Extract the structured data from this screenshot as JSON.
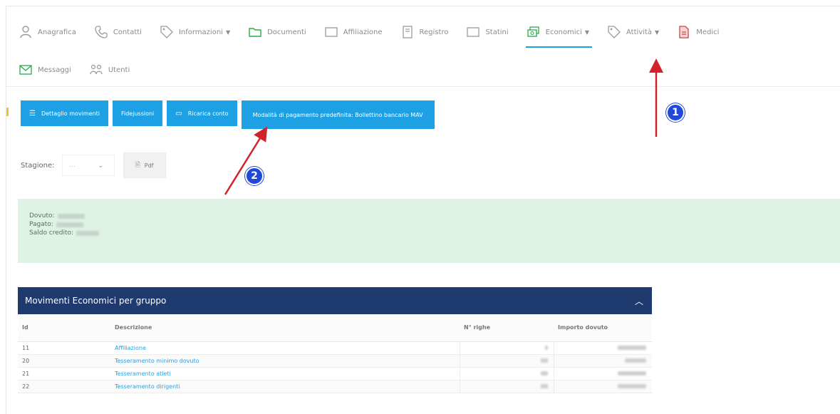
{
  "nav": {
    "row1": [
      {
        "label": "Anagrafica",
        "icon": "person-icon",
        "caret": false
      },
      {
        "label": "Contatti",
        "icon": "phone-icon",
        "caret": false
      },
      {
        "label": "Informazioni",
        "icon": "tag-icon",
        "caret": true
      },
      {
        "label": "Documenti",
        "icon": "folder-icon",
        "caret": false
      },
      {
        "label": "Affiliazione",
        "icon": "frame-icon",
        "caret": false
      },
      {
        "label": "Registro",
        "icon": "book-icon",
        "caret": false
      },
      {
        "label": "Statini",
        "icon": "frame-icon",
        "caret": false
      },
      {
        "label": "Economici",
        "icon": "money-icon",
        "caret": true,
        "active": true
      },
      {
        "label": "Attività",
        "icon": "tag-icon",
        "caret": true
      },
      {
        "label": "Medici",
        "icon": "file-icon",
        "caret": false
      }
    ],
    "row2": [
      {
        "label": "Messaggi",
        "icon": "envelope-icon"
      },
      {
        "label": "Utenti",
        "icon": "users-icon"
      }
    ]
  },
  "buttons": {
    "dettaglio": "Dettaglio movimenti",
    "fidejussioni": "Fidejussioni",
    "ricarica": "Ricarica conto",
    "modalita": "Modalità di pagamento predefinita: Bollettino bancario MAV"
  },
  "season": {
    "label": "Stagione:",
    "value": "...",
    "pdf": "Pdf"
  },
  "summary": {
    "dovuto_label": "Dovuto:",
    "pagato_label": "Pagato:",
    "saldo_label": "Saldo credito:"
  },
  "table": {
    "title": "Movimenti Economici per gruppo",
    "headers": [
      "Id",
      "Descrizione",
      "N° righe",
      "Importo dovuto"
    ],
    "rows": [
      {
        "id": "11",
        "desc": "Affiliazione"
      },
      {
        "id": "20",
        "desc": "Tesseramento minimo dovuto"
      },
      {
        "id": "21",
        "desc": "Tesseramento atleti"
      },
      {
        "id": "22",
        "desc": "Tesseramento dirigenti"
      }
    ]
  },
  "annotations": {
    "badge1": "1",
    "badge2": "2"
  },
  "colors": {
    "accent": "#1ea0e4",
    "header": "#1f3a6e",
    "summary_bg": "#def3e6",
    "arrow": "#d2232a",
    "badge": "#1f49d6"
  }
}
